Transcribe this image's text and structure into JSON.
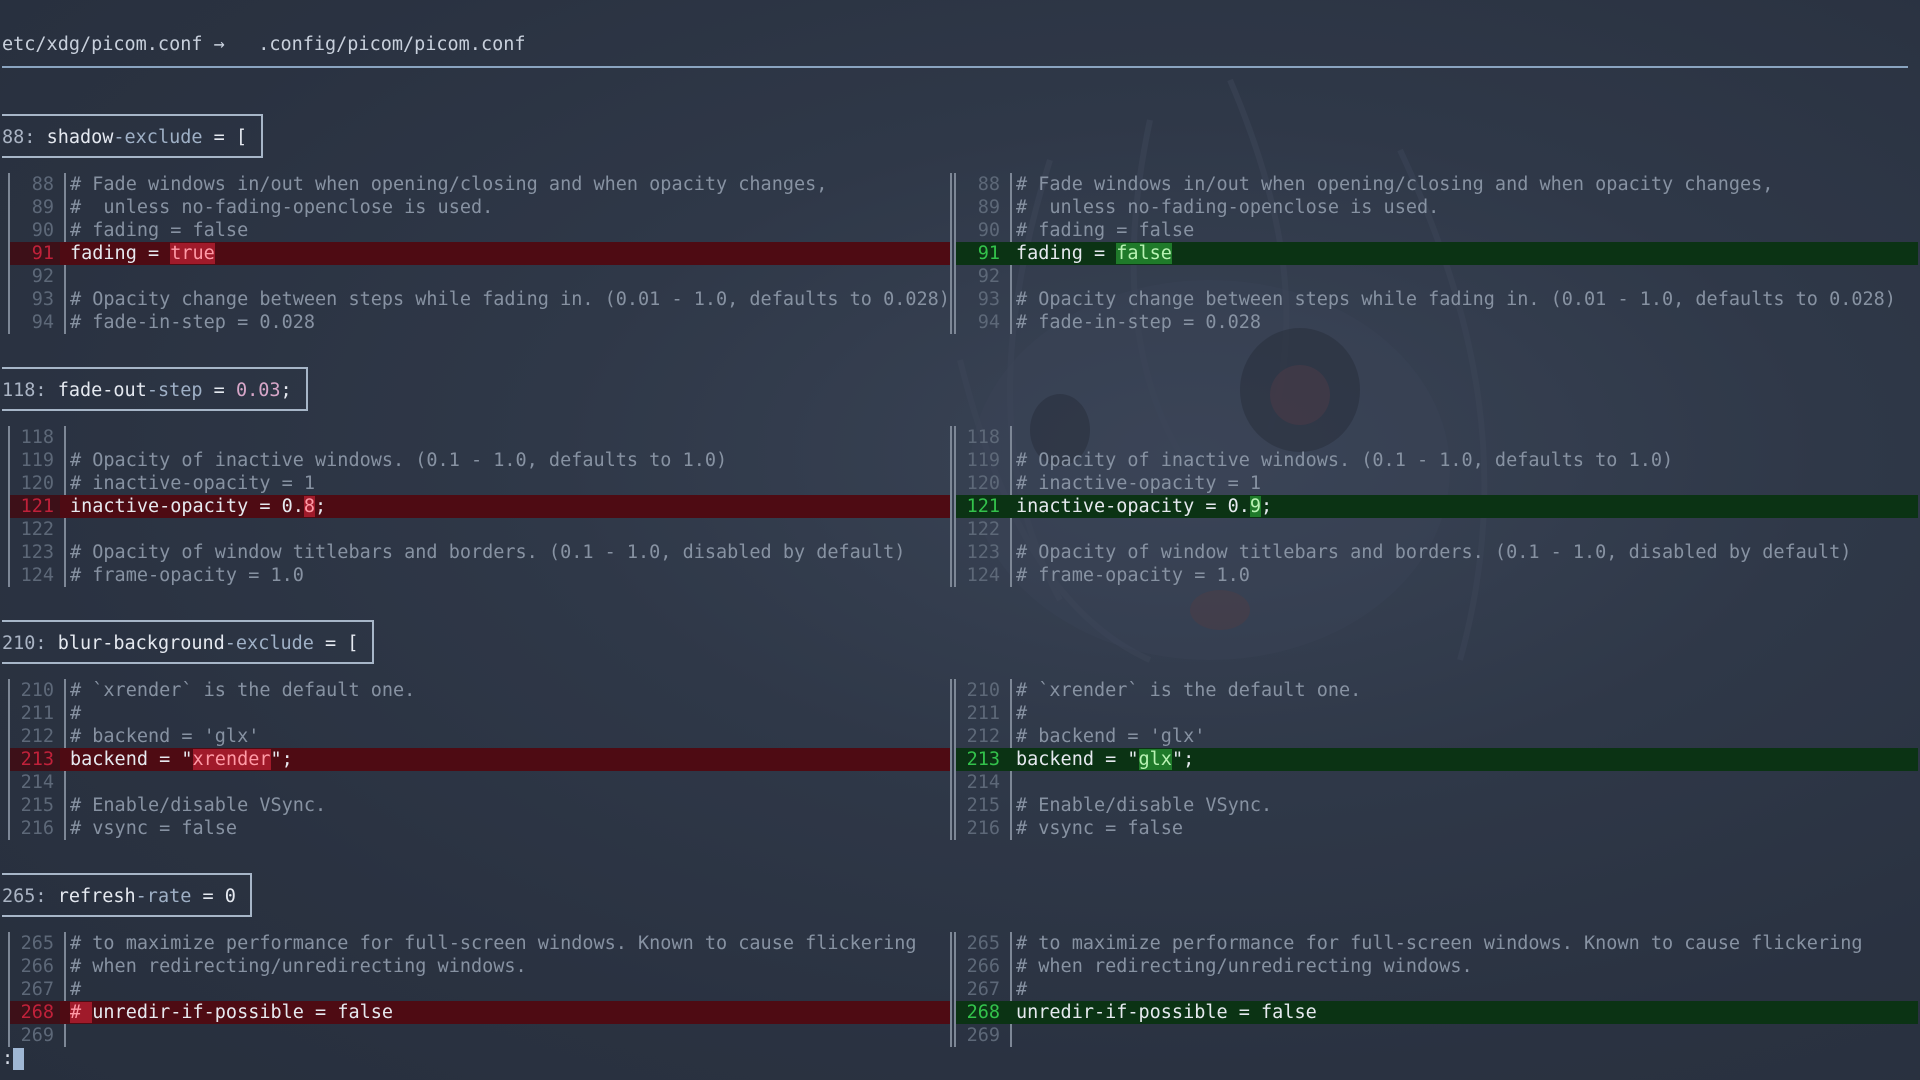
{
  "header": {
    "left_path": "etc/xdg/picom.conf",
    "arrow": "→",
    "right_path": ".config/picom/picom.conf"
  },
  "hunks": [
    {
      "label_num": "88",
      "label_parts": [
        "shadow",
        "-exclude",
        " = ["
      ],
      "lines": [
        {
          "n": "88",
          "t": "# Fade windows in/out when opening/closing and when opacity changes,"
        },
        {
          "n": "89",
          "t": "#  unless no-fading-openclose is used."
        },
        {
          "n": "90",
          "t": "# fading = false"
        },
        {
          "n": "91",
          "old_pre": "fading = ",
          "old_hl": "true",
          "old_post": "",
          "new_pre": "fading = ",
          "new_hl": "false",
          "new_post": ""
        },
        {
          "n": "92",
          "t": ""
        },
        {
          "n": "93",
          "t": "# Opacity change between steps while fading in. (0.01 - 1.0, defaults to 0.028)"
        },
        {
          "n": "94",
          "t": "# fade-in-step = 0.028"
        }
      ]
    },
    {
      "label_num": "118",
      "label_parts": [
        "fade-out",
        "-step",
        " = ",
        "0.03",
        ";"
      ],
      "lines": [
        {
          "n": "118",
          "t": ""
        },
        {
          "n": "119",
          "t": "# Opacity of inactive windows. (0.1 - 1.0, defaults to 1.0)"
        },
        {
          "n": "120",
          "t": "# inactive-opacity = 1"
        },
        {
          "n": "121",
          "old_pre": "inactive-opacity = 0.",
          "old_hl": "8",
          "old_post": ";",
          "new_pre": "inactive-opacity = 0.",
          "new_hl": "9",
          "new_post": ";"
        },
        {
          "n": "122",
          "t": ""
        },
        {
          "n": "123",
          "t": "# Opacity of window titlebars and borders. (0.1 - 1.0, disabled by default)"
        },
        {
          "n": "124",
          "t": "# frame-opacity = 1.0"
        }
      ]
    },
    {
      "label_num": "210",
      "label_parts": [
        "blur-background",
        "-exclude",
        " = ["
      ],
      "lines": [
        {
          "n": "210",
          "t": "# `xrender` is the default one."
        },
        {
          "n": "211",
          "t": "#"
        },
        {
          "n": "212",
          "t": "# backend = 'glx'"
        },
        {
          "n": "213",
          "old_pre": "backend = \"",
          "old_hl": "xrender",
          "old_post": "\";",
          "new_pre": "backend = \"",
          "new_hl": "glx",
          "new_post": "\";"
        },
        {
          "n": "214",
          "t": ""
        },
        {
          "n": "215",
          "t": "# Enable/disable VSync."
        },
        {
          "n": "216",
          "t": "# vsync = false"
        }
      ]
    },
    {
      "label_num": "265",
      "label_parts": [
        "refresh",
        "-rate",
        " = 0"
      ],
      "lines": [
        {
          "n": "265",
          "t": "# to maximize performance for full-screen windows. Known to cause flickering"
        },
        {
          "n": "266",
          "t": "# when redirecting/unredirecting windows."
        },
        {
          "n": "267",
          "t": "#"
        },
        {
          "n": "268",
          "old_pre": "",
          "old_hl": "# ",
          "old_post": "unredir-if-possible = false",
          "new_pre": "unredir-if-possible = false",
          "new_hl": "",
          "new_post": ""
        },
        {
          "n": "269",
          "t": ""
        }
      ]
    }
  ],
  "prompt": ":",
  "colors": {
    "deleted_bg": "#4e0b13",
    "added_bg": "#0b3314",
    "deleted_hl": "#a01a2a",
    "added_hl": "#1f7a2a"
  }
}
